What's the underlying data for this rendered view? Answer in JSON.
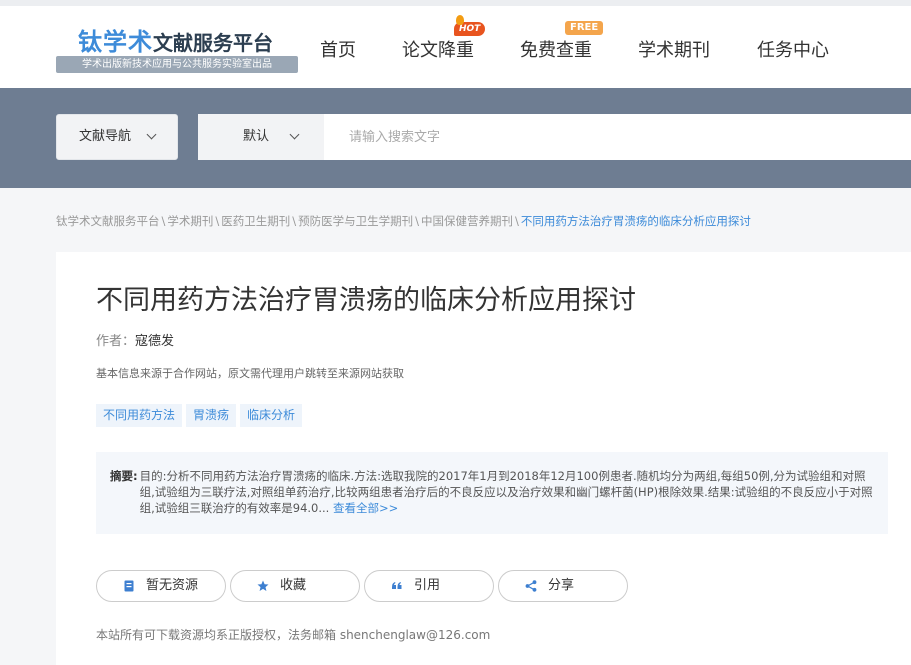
{
  "logo": {
    "brand": "钛学术",
    "rest": "文献服务平台",
    "subtitle": "学术出版新技术应用与公共服务实验室出品"
  },
  "nav": {
    "items": [
      {
        "label": "首页"
      },
      {
        "label": "论文降重",
        "badge": "HOT"
      },
      {
        "label": "免费查重",
        "badge": "FREE"
      },
      {
        "label": "学术期刊"
      },
      {
        "label": "任务中心"
      }
    ]
  },
  "search": {
    "nav_select": "文献导航",
    "default_select": "默认",
    "placeholder": "请输入搜索文字"
  },
  "breadcrumb": [
    "钛学术文献服务平台",
    "学术期刊",
    "医药卫生期刊",
    "预防医学与卫生学期刊",
    "中国保健营养期刊",
    "不同用药方法治疗胃溃疡的临床分析应用探讨"
  ],
  "article": {
    "title": "不同用药方法治疗胃溃疡的临床分析应用探讨",
    "author_label": "作者：",
    "author": "寇德发",
    "source_note": "基本信息来源于合作网站，原文需代理用户跳转至来源网站获取",
    "keywords": [
      "不同用药方法",
      "胃溃疡",
      "临床分析"
    ],
    "abstract_label": "摘要:",
    "abstract": "目的:分析不同用药方法治疗胃溃疡的临床.方法:选取我院的2017年1月到2018年12月100例患者.随机均分为两组,每组50例,分为试验组和对照组,试验组为三联疗法,对照组单药治疗,比较两组患者治疗后的不良反应以及治疗效果和幽门螺杆菌(HP)根除效果.结果:试验组的不良反应小于对照组,试验组三联治疗的有效率是94.0...",
    "view_all": "查看全部>>"
  },
  "actions": {
    "no_resource": "暂无资源",
    "favorite": "收藏",
    "cite": "引用",
    "share": "分享"
  },
  "footer_note": "本站所有可下载资源均系正版授权，法务邮箱 shenchenglaw@126.com",
  "colors": {
    "accent": "#3d8bd9",
    "search_band": "#6e7d92",
    "hot": "#e8541f",
    "free": "#f4a54c"
  }
}
